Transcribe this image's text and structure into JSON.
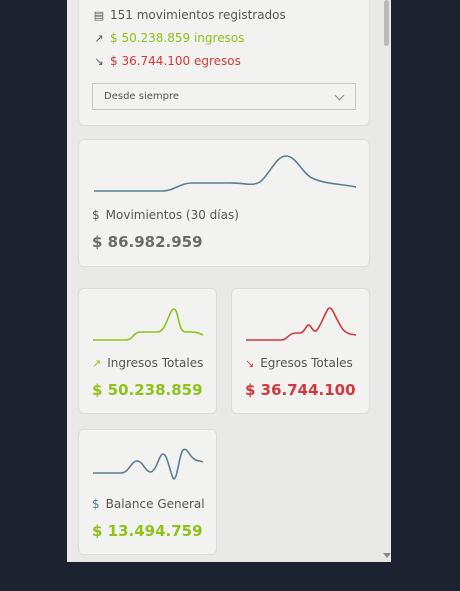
{
  "summary": {
    "movements": "151 movimientos registrados",
    "income": "$ 50.238.859 ingresos",
    "expense": "$ 36.744.100 egresos",
    "period_select": "Desde siempre"
  },
  "cards": {
    "movements": {
      "label": "Movimientos (30 días)",
      "value": "$ 86.982.959"
    },
    "income": {
      "label": "Ingresos Totales",
      "value": "$ 50.238.859"
    },
    "expense": {
      "label": "Egresos Totales",
      "value": "$ 36.744.100"
    },
    "balance": {
      "label": "Balance General",
      "value": "$ 13.494.759"
    }
  },
  "colors": {
    "income": "#8ec21b",
    "expense": "#d0393d",
    "neutral": "#5b7f92",
    "text": "#555555",
    "value_dark": "#6b6b6b"
  },
  "icons": {
    "movements": "document-icon",
    "income": "trending-up-icon",
    "expense": "trending-down-icon",
    "currency": "dollar-icon"
  }
}
